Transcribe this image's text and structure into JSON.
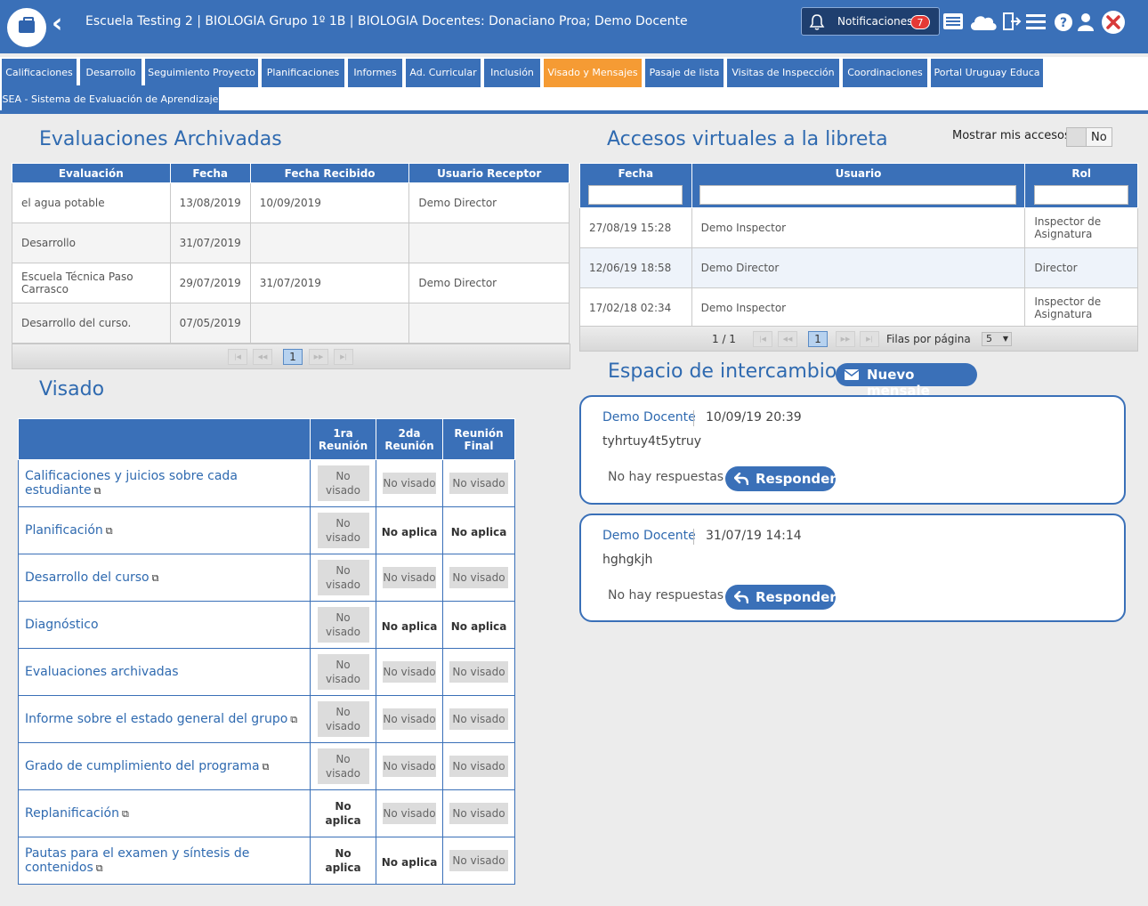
{
  "header": {
    "title": "Escuela Testing 2 | BIOLOGIA Grupo 1º 1B | BIOLOGIA Docentes: Donaciano Proa; Demo Docente",
    "notifications_label": "Notificaciones",
    "notifications_count": "7",
    "icons": [
      "bell-icon",
      "news-icon",
      "cloud-icon",
      "export-icon",
      "menu-icon",
      "help-icon",
      "user-icon",
      "close-icon"
    ]
  },
  "tabs": [
    {
      "label": "Calificaciones",
      "active": false
    },
    {
      "label": "Desarrollo",
      "active": false
    },
    {
      "label": "Seguimiento Proyecto",
      "active": false
    },
    {
      "label": "Planificaciones",
      "active": false
    },
    {
      "label": "Informes",
      "active": false
    },
    {
      "label": "Ad. Curricular",
      "active": false
    },
    {
      "label": "Inclusión",
      "active": false
    },
    {
      "label": "Visado y Mensajes",
      "active": true
    },
    {
      "label": "Pasaje de lista",
      "active": false
    },
    {
      "label": "Visitas de Inspección",
      "active": false
    },
    {
      "label": "Coordinaciones",
      "active": false
    },
    {
      "label": "Portal Uruguay Educa",
      "active": false
    },
    {
      "label": "SEA - Sistema de Evaluación de Aprendizaje",
      "active": false
    }
  ],
  "archivadas": {
    "title": "Evaluaciones Archivadas",
    "headers": [
      "Evaluación",
      "Fecha",
      "Fecha Recibido",
      "Usuario Receptor"
    ],
    "rows": [
      [
        "el agua potable",
        "13/08/2019",
        "10/09/2019",
        "Demo Director"
      ],
      [
        "Desarrollo",
        "31/07/2019",
        "",
        ""
      ],
      [
        "Escuela Técnica Paso Carrasco",
        "29/07/2019",
        "31/07/2019",
        "Demo Director"
      ],
      [
        "Desarrollo del curso.",
        "07/05/2019",
        "",
        ""
      ]
    ],
    "page": "1"
  },
  "accesos": {
    "title": "Accesos virtuales a la libreta",
    "toggle_label": "Mostrar mis accesos",
    "toggle_value": "No",
    "headers": [
      "Fecha",
      "Usuario",
      "Rol"
    ],
    "rows": [
      [
        "27/08/19 15:28",
        "Demo Inspector",
        "Inspector de Asignatura"
      ],
      [
        "12/06/19 18:58",
        "Demo Director",
        "Director"
      ],
      [
        "17/02/18 02:34",
        "Demo Inspector",
        "Inspector de Asignatura"
      ]
    ],
    "page_info": "1 / 1",
    "page": "1",
    "rows_per_page_label": "Filas por página",
    "rows_per_page": "5"
  },
  "visado": {
    "title": "Visado",
    "headers": [
      "",
      "1ra Reunión",
      "2da Reunión",
      "Reunión Final"
    ],
    "rows": [
      {
        "label": "Calificaciones y juicios sobre cada estudiante",
        "ext": true,
        "c1": "No visado",
        "c2": "No visado",
        "c3": "No visado"
      },
      {
        "label": "Planificación",
        "ext": true,
        "c1": "No visado",
        "c2": "No aplica",
        "c3": "No aplica"
      },
      {
        "label": "Desarrollo del curso",
        "ext": true,
        "c1": "No visado",
        "c2": "No visado",
        "c3": "No visado"
      },
      {
        "label": "Diagnóstico",
        "ext": false,
        "c1": "No visado",
        "c2": "No aplica",
        "c3": "No aplica"
      },
      {
        "label": "Evaluaciones archivadas",
        "ext": false,
        "c1": "No visado",
        "c2": "No visado",
        "c3": "No visado"
      },
      {
        "label": "Informe sobre el estado general del grupo",
        "ext": true,
        "c1": "No visado",
        "c2": "No visado",
        "c3": "No visado"
      },
      {
        "label": "Grado de cumplimiento del programa",
        "ext": true,
        "c1": "No visado",
        "c2": "No visado",
        "c3": "No visado"
      },
      {
        "label": "Replanificación",
        "ext": true,
        "c1": "No aplica",
        "c2": "No visado",
        "c3": "No visado"
      },
      {
        "label": "Pautas para el examen y síntesis de contenidos",
        "ext": true,
        "c1": "No aplica",
        "c2": "No aplica",
        "c3": "No visado"
      }
    ]
  },
  "intercambio": {
    "title": "Espacio de intercambio",
    "new_message_label": "Nuevo mensaje",
    "messages": [
      {
        "author": "Demo Docente",
        "date": "10/09/19 20:39",
        "body": "tyhrtuy4t5ytruy",
        "replies": "No hay respuestas",
        "reply_label": "Responder"
      },
      {
        "author": "Demo Docente",
        "date": "31/07/19 14:14",
        "body": "hghgkjh",
        "replies": "No hay respuestas",
        "reply_label": "Responder"
      }
    ]
  },
  "colors": {
    "primary": "#3a70b8",
    "active_tab": "#f59b34",
    "badge": "#e53935"
  }
}
